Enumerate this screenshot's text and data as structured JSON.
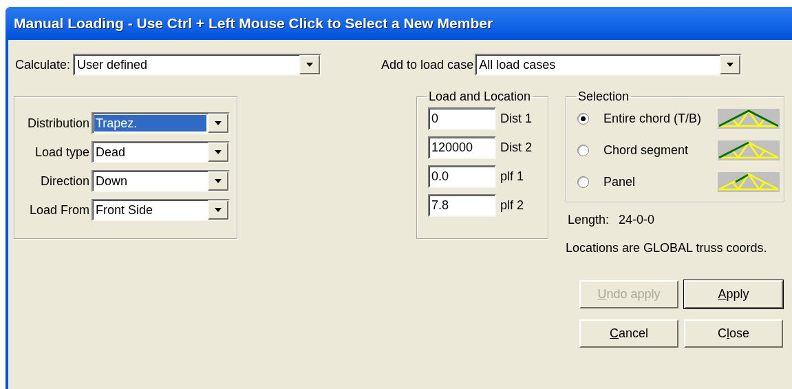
{
  "window": {
    "title": "Manual Loading - Use Ctrl + Left Mouse Click to Select a New Member"
  },
  "calculate": {
    "label": "Calculate:",
    "value": "User defined"
  },
  "load_case": {
    "label": "Add to load case",
    "value": "All load cases"
  },
  "load_fields": [
    {
      "label": "Distribution",
      "value": "Trapez.",
      "highlighted": true
    },
    {
      "label": "Load type",
      "value": "Dead",
      "highlighted": false
    },
    {
      "label": "Direction",
      "value": "Down",
      "highlighted": false
    },
    {
      "label": "Load From",
      "value": "Front Side",
      "highlighted": false
    }
  ],
  "load_and_location": {
    "title": "Load and Location",
    "fields": [
      {
        "value": "0",
        "label": "Dist 1"
      },
      {
        "value": "120000",
        "label": "Dist 2"
      },
      {
        "value": "0.0",
        "label": "plf 1"
      },
      {
        "value": "7.8",
        "label": "plf 2"
      }
    ]
  },
  "selection": {
    "title": "Selection",
    "options": [
      {
        "label": "Entire chord (T/B)",
        "selected": true,
        "kind": "entire"
      },
      {
        "label": "Chord segment",
        "selected": false,
        "kind": "segment"
      },
      {
        "label": "Panel",
        "selected": false,
        "kind": "panel"
      }
    ]
  },
  "length": {
    "label": "Length:",
    "value": "24-0-0"
  },
  "note": "Locations are GLOBAL truss coords.",
  "buttons": [
    {
      "key": "U",
      "post": "ndo apply",
      "disabled": true,
      "default": false
    },
    {
      "key": "A",
      "post": "pply",
      "disabled": false,
      "default": true
    },
    {
      "key": "C",
      "post": "ancel",
      "disabled": false,
      "default": false
    },
    {
      "pre": "C",
      "key": "l",
      "post": "ose",
      "disabled": false,
      "default": false
    }
  ]
}
